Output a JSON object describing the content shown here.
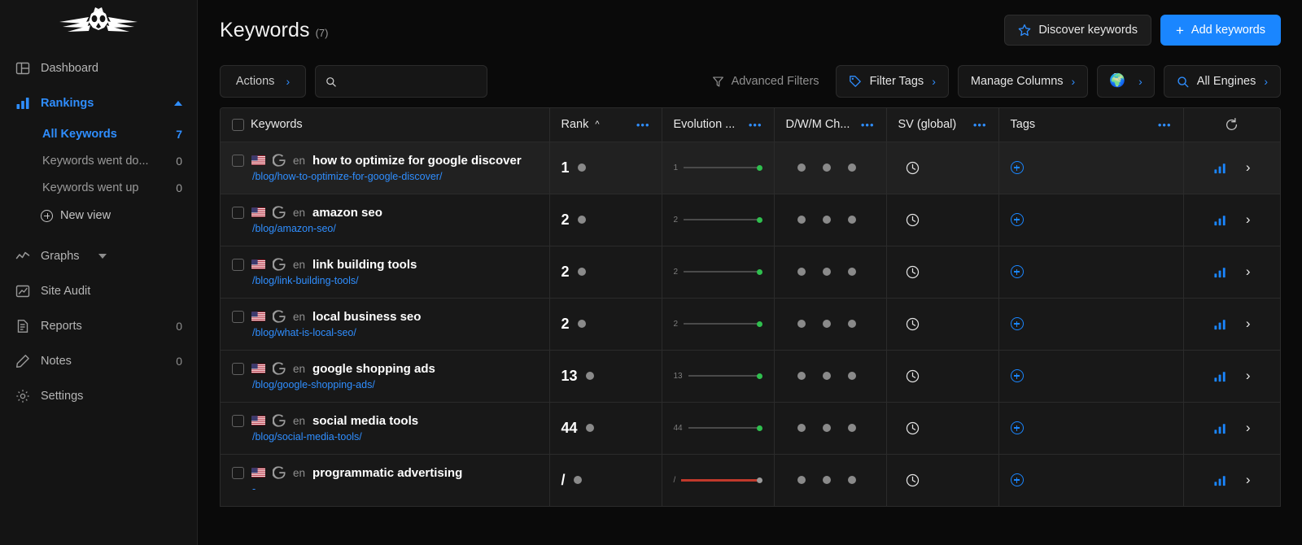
{
  "sidebar": {
    "logo": "owl-logo",
    "items": [
      {
        "label": "Dashboard",
        "icon": "dashboard-icon",
        "count": ""
      },
      {
        "label": "Rankings",
        "icon": "rankings-bar-icon",
        "count": ""
      },
      {
        "label": "Graphs",
        "icon": "graphs-line-icon",
        "count": ""
      },
      {
        "label": "Site Audit",
        "icon": "site-audit-icon",
        "count": ""
      },
      {
        "label": "Reports",
        "icon": "reports-doc-icon",
        "count": "0"
      },
      {
        "label": "Notes",
        "icon": "notes-pencil-icon",
        "count": "0"
      },
      {
        "label": "Settings",
        "icon": "gear-icon",
        "count": ""
      }
    ],
    "rankings_sub": [
      {
        "label": "All Keywords",
        "count": "7"
      },
      {
        "label": "Keywords went do...",
        "count": "0"
      },
      {
        "label": "Keywords went up",
        "count": "0"
      }
    ],
    "new_view_label": "New view"
  },
  "header": {
    "title": "Keywords",
    "count": "(7)",
    "discover_label": "Discover keywords",
    "add_label": "Add keywords",
    "add_plus": "+"
  },
  "toolbar": {
    "actions_label": "Actions",
    "search_placeholder": "",
    "search_value": "",
    "advanced_filters_label": "Advanced Filters",
    "filter_tags_label": "Filter Tags",
    "manage_columns_label": "Manage Columns",
    "globe_label": "",
    "all_engines_label": "All Engines",
    "chevron": "›"
  },
  "table": {
    "columns": [
      {
        "label": "Keywords",
        "sort": "",
        "dots": ""
      },
      {
        "label": "Rank",
        "sort": "^",
        "dots": "•••"
      },
      {
        "label": "Evolution ...",
        "sort": "",
        "dots": "•••"
      },
      {
        "label": "D/W/M Ch...",
        "sort": "",
        "dots": "•••"
      },
      {
        "label": "SV (global)",
        "sort": "",
        "dots": "•••"
      },
      {
        "label": "Tags",
        "sort": "",
        "dots": "•••"
      },
      {
        "label": "",
        "sort": "",
        "dots": ""
      }
    ],
    "rows": [
      {
        "keyword": "how to optimize for google discover",
        "url": "/blog/how-to-optimize-for-google-discover/",
        "lang": "en",
        "engine": "google-icon",
        "country": "us-flag-icon",
        "rank": "1",
        "evolution_label": "1",
        "evolution_trend": "up",
        "evolution_color": "#2fbf4e",
        "sv": "pending",
        "hover": true
      },
      {
        "keyword": "amazon seo",
        "url": "/blog/amazon-seo/",
        "lang": "en",
        "engine": "google-icon",
        "country": "us-flag-icon",
        "rank": "2",
        "evolution_label": "2",
        "evolution_trend": "up",
        "evolution_color": "#2fbf4e",
        "sv": "pending",
        "hover": false
      },
      {
        "keyword": "link building tools",
        "url": "/blog/link-building-tools/",
        "lang": "en",
        "engine": "google-icon",
        "country": "us-flag-icon",
        "rank": "2",
        "evolution_label": "2",
        "evolution_trend": "up",
        "evolution_color": "#2fbf4e",
        "sv": "pending",
        "hover": false
      },
      {
        "keyword": "local business seo",
        "url": "/blog/what-is-local-seo/",
        "lang": "en",
        "engine": "google-icon",
        "country": "us-flag-icon",
        "rank": "2",
        "evolution_label": "2",
        "evolution_trend": "up",
        "evolution_color": "#2fbf4e",
        "sv": "pending",
        "hover": false
      },
      {
        "keyword": "google shopping ads",
        "url": "/blog/google-shopping-ads/",
        "lang": "en",
        "engine": "google-icon",
        "country": "us-flag-icon",
        "rank": "13",
        "evolution_label": "13",
        "evolution_trend": "up",
        "evolution_color": "#2fbf4e",
        "sv": "pending",
        "hover": false
      },
      {
        "keyword": "social media tools",
        "url": "/blog/social-media-tools/",
        "lang": "en",
        "engine": "google-icon",
        "country": "us-flag-icon",
        "rank": "44",
        "evolution_label": "44",
        "evolution_trend": "up",
        "evolution_color": "#2fbf4e",
        "sv": "pending",
        "hover": false
      },
      {
        "keyword": "programmatic advertising",
        "url": "-",
        "lang": "en",
        "engine": "google-icon",
        "country": "us-flag-icon",
        "rank": "/",
        "evolution_label": "/",
        "evolution_trend": "down",
        "evolution_color": "#c0392b",
        "sv": "pending",
        "hover": false
      }
    ]
  },
  "colors": {
    "accent": "#1a86ff",
    "accent_text": "#2f8eff",
    "positive": "#2fbf4e",
    "negative": "#c0392b",
    "bg": "#0a0a0a",
    "sidebar_bg": "#141414",
    "row_bg": "#181818",
    "row_hover": "#212121",
    "header_bg": "#1a1a1a",
    "border": "#2b2b2b"
  }
}
